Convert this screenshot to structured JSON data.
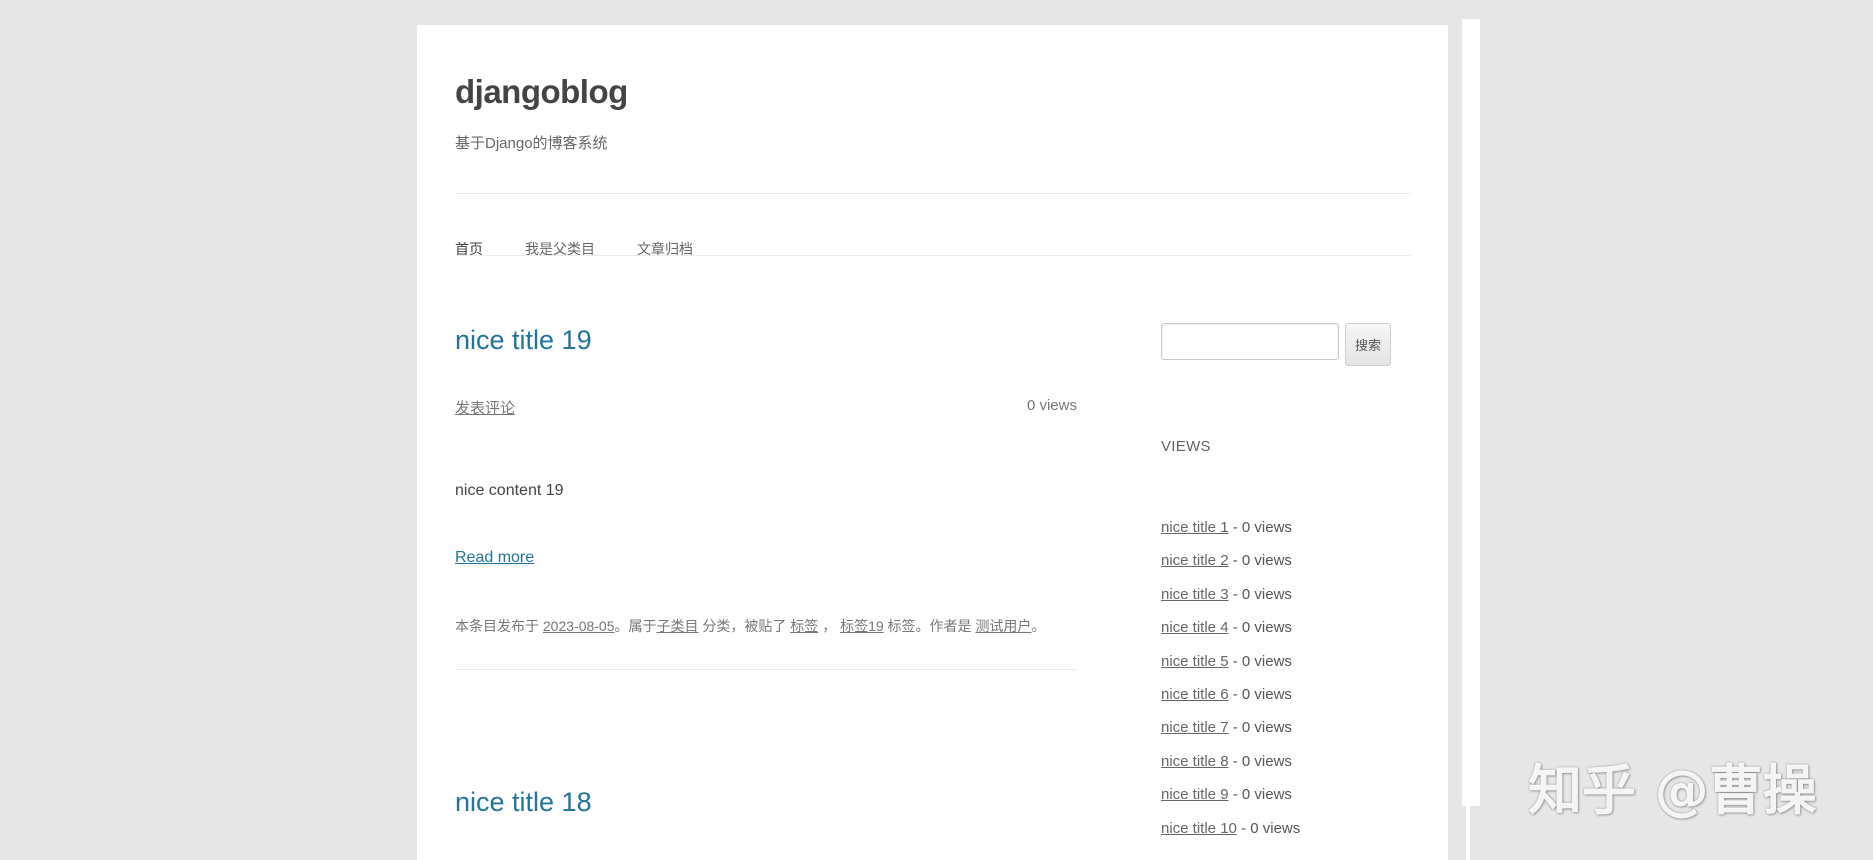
{
  "site": {
    "title": "djangoblog",
    "description": "基于Django的博客系统"
  },
  "nav": {
    "items": [
      "首页",
      "我是父类目",
      "文章归档"
    ]
  },
  "posts": [
    {
      "title": "nice title 19",
      "comment_link": "发表评论",
      "views": "0 views",
      "content": "nice content 19",
      "read_more": "Read more",
      "meta": {
        "prefix": "本条目发布于",
        "date": "2023-08-05",
        "category_prefix": "。属于",
        "category": "子类目",
        "category_suffix": "分类，被贴了",
        "tag1": "标签",
        "tag_sep": "，",
        "tag2": "标签19",
        "tag_suffix": "标签。作者是",
        "author": "测试用户",
        "end": "。"
      }
    },
    {
      "title": "nice title 18"
    }
  ],
  "sidebar": {
    "search_button": "搜索",
    "search_placeholder": "",
    "views_heading": "VIEWS",
    "views_items": [
      {
        "title": "nice title 1",
        "views": "- 0 views"
      },
      {
        "title": "nice title 2",
        "views": "- 0 views"
      },
      {
        "title": "nice title 3",
        "views": "- 0 views"
      },
      {
        "title": "nice title 4",
        "views": "- 0 views"
      },
      {
        "title": "nice title 5",
        "views": "- 0 views"
      },
      {
        "title": "nice title 6",
        "views": "- 0 views"
      },
      {
        "title": "nice title 7",
        "views": "- 0 views"
      },
      {
        "title": "nice title 8",
        "views": "- 0 views"
      },
      {
        "title": "nice title 9",
        "views": "- 0 views"
      },
      {
        "title": "nice title 10",
        "views": "- 0 views"
      }
    ]
  },
  "watermark": "知乎 @曹操"
}
